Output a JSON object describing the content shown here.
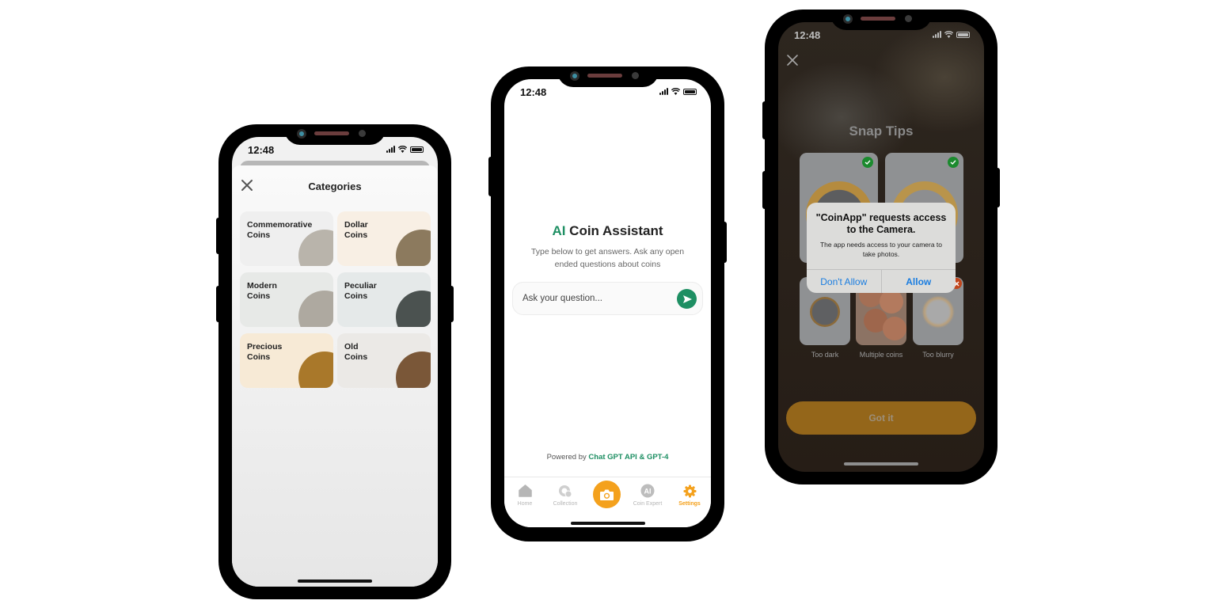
{
  "status_bar": {
    "time": "12:48"
  },
  "categories_screen": {
    "title": "Categories",
    "close_icon": "close-icon",
    "items": [
      {
        "label": "Commemorative\nCoins",
        "bg": "#efefef",
        "coin_color": "#b9b4ab"
      },
      {
        "label": "Dollar\nCoins",
        "bg": "#f8efe4",
        "coin_color": "#8c7a5e"
      },
      {
        "label": "Modern\nCoins",
        "bg": "#e7e9e7",
        "coin_color": "#aea9a0"
      },
      {
        "label": "Peculiar\nCoins",
        "bg": "#e5e9e9",
        "coin_color": "#4b5250"
      },
      {
        "label": "Precious\nCoins",
        "bg": "#f7ead6",
        "coin_color": "#a9782a"
      },
      {
        "label": "Old\nCoins",
        "bg": "#ebe9e6",
        "coin_color": "#7a5738"
      }
    ]
  },
  "assistant_screen": {
    "title_accent": "AI",
    "title_rest": " Coin Assistant",
    "subtitle": "Type below to get answers. Ask any open ended questions about coins",
    "input_placeholder": "Ask your question...",
    "send_icon": "send-icon",
    "powered_prefix": "Powered by ",
    "powered_accent": "Chat GPT API & GPT-4",
    "accent_color": "#1e8f63",
    "tabs": [
      {
        "label": "Home",
        "icon": "home-icon",
        "active": false
      },
      {
        "label": "Collection",
        "icon": "collection-icon",
        "active": false
      },
      {
        "label": "",
        "icon": "camera-icon",
        "active": false
      },
      {
        "label": "Coin Expert",
        "icon": "ai-icon",
        "active": false
      },
      {
        "label": "Settings",
        "icon": "gear-icon",
        "active": true
      }
    ],
    "tab_active_color": "#f4a11d"
  },
  "snap_tips_screen": {
    "title": "Snap Tips",
    "close_icon": "close-icon",
    "good_examples": [
      {
        "status": "good"
      },
      {
        "status": "good"
      }
    ],
    "bad_examples": [
      {
        "label": "Too dark",
        "status": "bad"
      },
      {
        "label": "Multiple coins",
        "status": "bad"
      },
      {
        "label": "Too blurry",
        "status": "bad"
      }
    ],
    "button_label": "Got it",
    "alert": {
      "title": "\"CoinApp\" requests access to the Camera.",
      "message": "The app needs access to your camera to take photos.",
      "deny_label": "Don't Allow",
      "allow_label": "Allow"
    }
  }
}
